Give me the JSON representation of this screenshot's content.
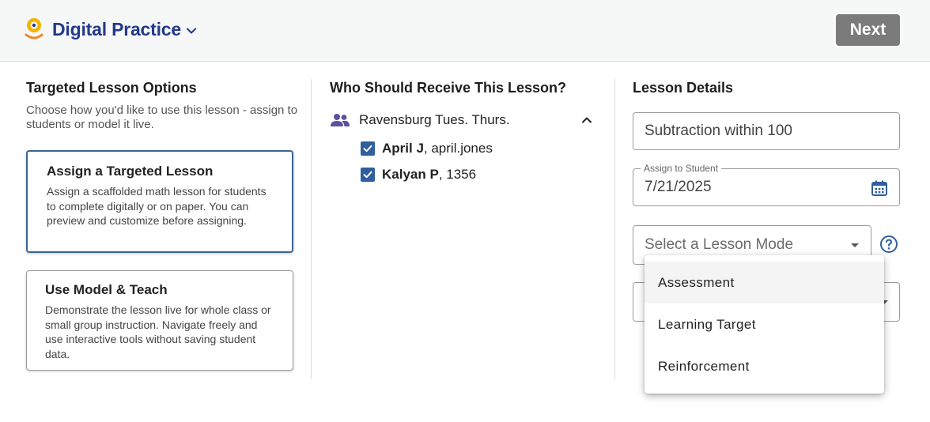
{
  "header": {
    "app_title": "Digital Practice",
    "next_label": "Next"
  },
  "options": {
    "title": "Targeted Lesson Options",
    "subtitle": "Choose how you'd like to use this lesson - assign to students or model it live.",
    "cards": [
      {
        "title": "Assign a Targeted Lesson",
        "description": "Assign a scaffolded math lesson for students to complete digitally or on paper. You can preview and customize before assigning.",
        "selected": true
      },
      {
        "title": "Use Model & Teach",
        "description": "Demonstrate the lesson live for whole class or small group instruction. Navigate freely and use interactive tools without saving student data.",
        "selected": false
      }
    ]
  },
  "recipients": {
    "title": "Who Should Receive This Lesson?",
    "class_name": "Ravensburg Tues. Thurs.",
    "students": [
      {
        "name": "April J",
        "detail": ", april.jones",
        "checked": true
      },
      {
        "name": "Kalyan P",
        "detail": ", 1356",
        "checked": true
      }
    ]
  },
  "details": {
    "title": "Lesson Details",
    "lesson_name": "Subtraction within 100",
    "assign_label": "Assign to Student",
    "assign_date": "7/21/2025",
    "mode_placeholder": "Select a Lesson Mode",
    "mode_options": [
      "Assessment",
      "Learning Target",
      "Reinforcement"
    ]
  },
  "colors": {
    "brand": "#233a8a",
    "accent": "#3b6592",
    "checkbox": "#2f5f9c",
    "button_disabled": "#7b7b7b"
  }
}
